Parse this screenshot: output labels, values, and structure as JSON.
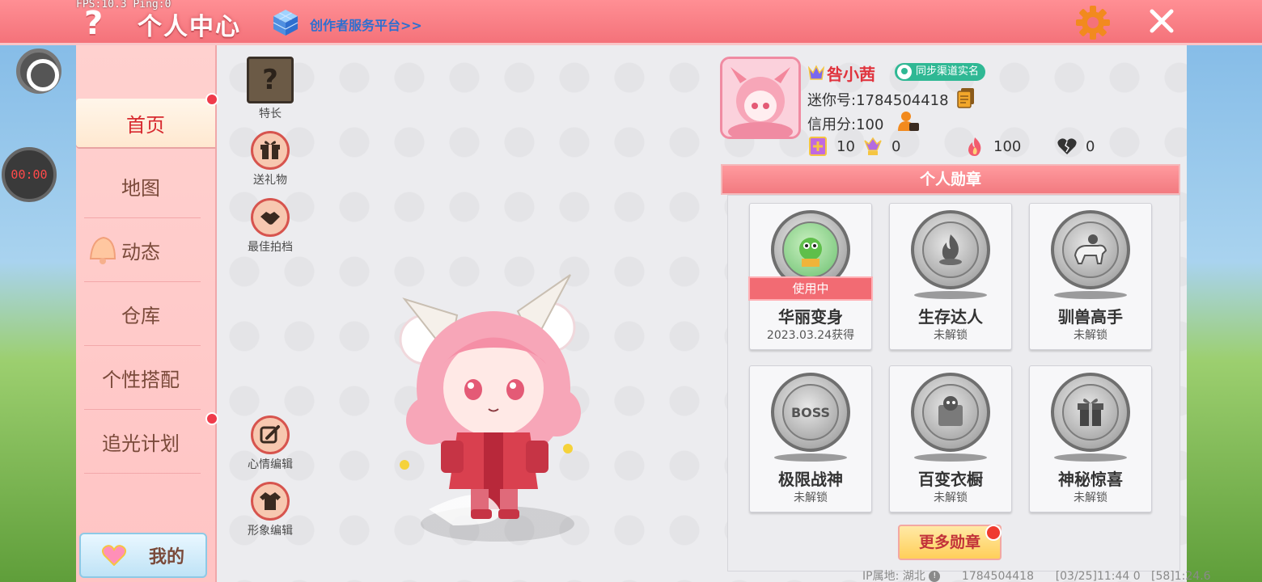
{
  "colors": {
    "accent": "#f4727a",
    "active_nav_text": "#d7292f",
    "link": "#2f6fcf",
    "badge_green": "#2fb894"
  },
  "overlay": {
    "fps_text": "FPS:10.3  Ping:0",
    "timer": "00:00"
  },
  "header": {
    "title": "个人中心",
    "help_icon": "question-mark-icon",
    "creator_link": "创作者服务平台>>",
    "settings_icon": "gear-icon",
    "close_icon": "close-icon"
  },
  "sidebar": {
    "items": [
      {
        "label": "首页",
        "active": true,
        "dot": true
      },
      {
        "label": "地图",
        "active": false,
        "dot": false
      },
      {
        "label": "动态",
        "active": false,
        "dot": false
      },
      {
        "label": "仓库",
        "active": false,
        "dot": false
      },
      {
        "label": "个性搭配",
        "active": false,
        "dot": false
      },
      {
        "label": "追光计划",
        "active": false,
        "dot": true
      }
    ],
    "mine_label": "我的"
  },
  "actions": {
    "specialty": "特长",
    "send_gift": "送礼物",
    "best_partner": "最佳拍档",
    "mood_edit": "心情编辑",
    "image_edit": "形象编辑"
  },
  "profile": {
    "nickname": "咎小茜",
    "sync_badge": "同步渠道实名",
    "mini_id": "迷你号:1784504418",
    "credit": "信用分:100",
    "stats": [
      {
        "icon": "flower-card-icon",
        "value": "10"
      },
      {
        "icon": "trophy-hands-icon",
        "value": "0"
      },
      {
        "icon": "flame-icon",
        "value": "100"
      },
      {
        "icon": "broken-heart-icon",
        "value": "0"
      }
    ]
  },
  "medals": {
    "header": "个人勋章",
    "items": [
      {
        "name": "华丽变身",
        "sub": "2023.03.24获得",
        "in_use": "使用中"
      },
      {
        "name": "生存达人",
        "sub": "未解锁"
      },
      {
        "name": "驯兽高手",
        "sub": "未解锁"
      },
      {
        "name": "极限战神",
        "sub": "未解锁",
        "disc_text": "BOSS"
      },
      {
        "name": "百变衣橱",
        "sub": "未解锁"
      },
      {
        "name": "神秘惊喜",
        "sub": "未解锁"
      }
    ],
    "more_label": "更多勋章"
  },
  "footer": {
    "ip_location": "IP属地: 湖北",
    "uid": "1784504418",
    "time1": "[03/25]11:44 0",
    "time2": "[58]1:24.6"
  }
}
